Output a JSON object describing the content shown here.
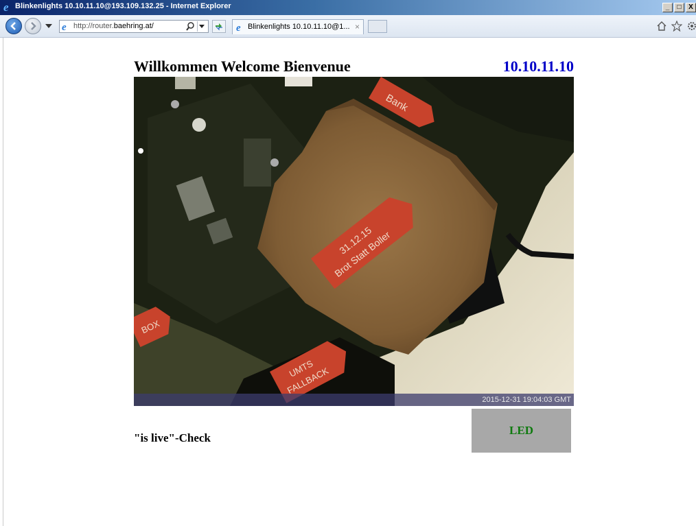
{
  "window": {
    "title": "Blinkenlights 10.10.11.10@193.109.132.25 - Internet Explorer",
    "controls": [
      "_",
      "□",
      "X"
    ]
  },
  "navbar": {
    "url_prefix": "http://router.",
    "url_domain": "baehring.at/",
    "tab_title": "Blinkenlights 10.10.11.10@1...",
    "tab_close": "×"
  },
  "page": {
    "welcome": "Willkommen Welcome Bienvenue",
    "ip": "10.10.11.10",
    "webcam": {
      "timestamp": "2015-12-31 19:04:03 GMT",
      "labels": {
        "bank": "Bank",
        "toast_line1": "31.12.15",
        "toast_line2": "Brot Statt Boller",
        "box": "BOX",
        "umts_line1": "UMTS",
        "umts_line2": "FALLBACK"
      }
    },
    "livecheck": "\"is live\"-Check",
    "led_label": "LED"
  },
  "colors": {
    "ip_text": "#0000c8",
    "led_text": "#0f7a0f",
    "led_bg": "#a8a8a8"
  }
}
